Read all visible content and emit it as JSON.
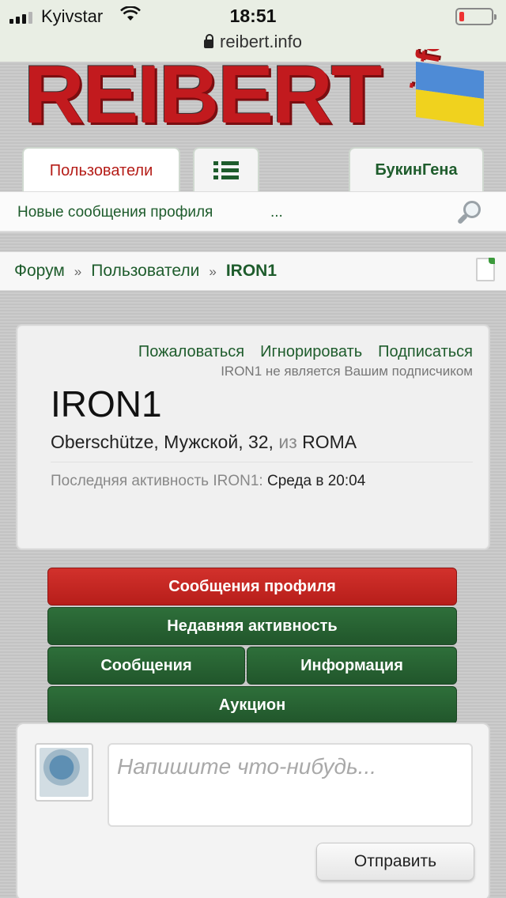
{
  "status_bar": {
    "carrier": "Kyivstar",
    "time": "18:51",
    "battery_level": 0.15
  },
  "browser": {
    "url": "reibert.info"
  },
  "logo": {
    "main": "REIBERT",
    "suffix": "info"
  },
  "tabs": {
    "users": "Пользователи",
    "account": "БукинГена"
  },
  "subnav": {
    "new_profile_posts": "Новые сообщения профиля",
    "more": "..."
  },
  "breadcrumb": {
    "items": [
      "Форум",
      "Пользователи"
    ],
    "separator": "»",
    "current": "IRON1"
  },
  "profile": {
    "actions": {
      "report": "Пожаловаться",
      "ignore": "Игнорировать",
      "follow": "Подписаться"
    },
    "follow_note": "IRON1 не является Вашим подписчиком",
    "username": "IRON1",
    "info_prefix": "Oberschütze, Мужской, 32,",
    "from_word": "из",
    "location": "ROMA",
    "last_activity_label": "Последняя активность IRON1:",
    "last_activity_value": "Среда в 20:04"
  },
  "profile_tabs": {
    "profile_posts": "Сообщения профиля",
    "recent_activity": "Недавняя активность",
    "posts": "Сообщения",
    "information": "Информация",
    "auction": "Аукцион"
  },
  "composer": {
    "placeholder": "Напишите что-нибудь...",
    "submit": "Отправить"
  },
  "colors": {
    "accent_green": "#1e5c2c",
    "accent_red": "#b51d18",
    "active_tab_red": "#d2312c"
  }
}
